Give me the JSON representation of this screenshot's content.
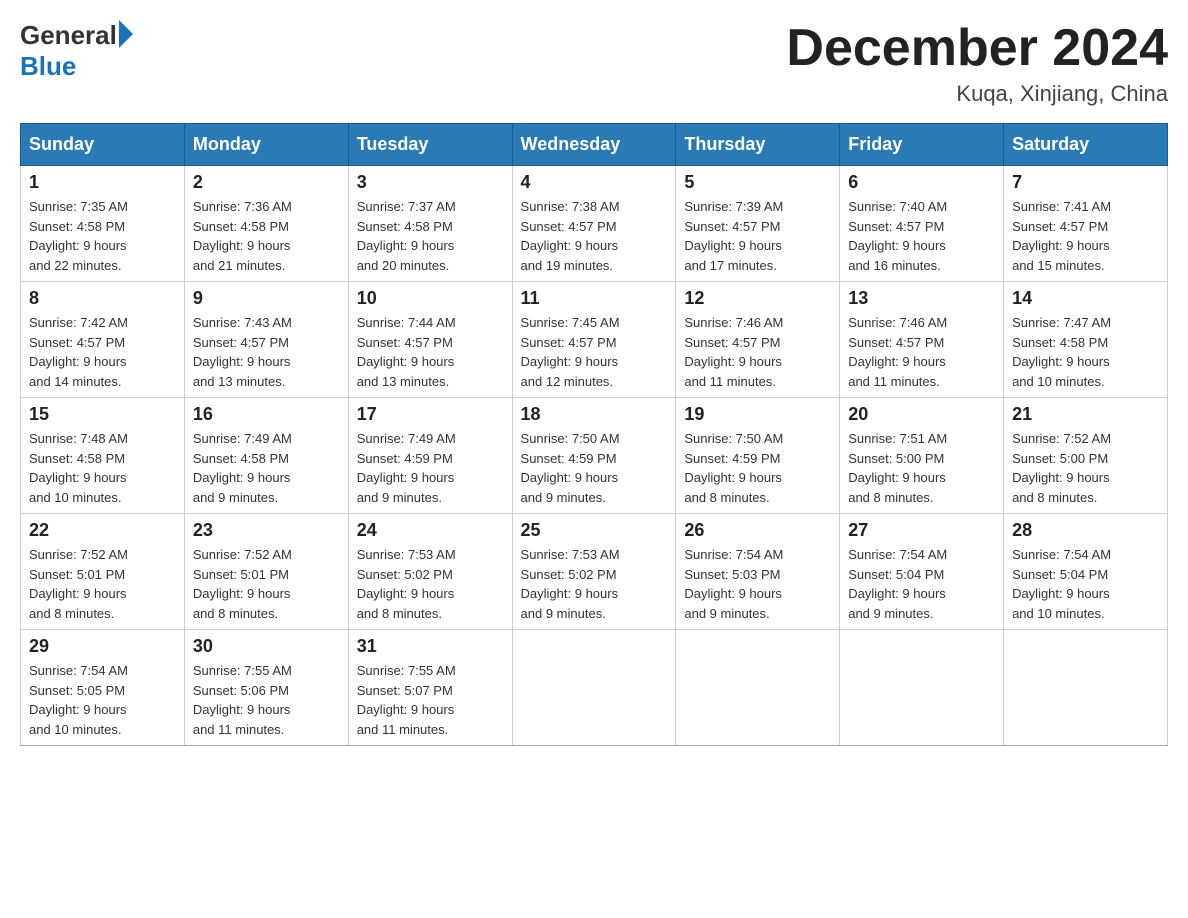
{
  "header": {
    "logo_general": "General",
    "logo_blue": "Blue",
    "month_title": "December 2024",
    "location": "Kuqa, Xinjiang, China"
  },
  "days_of_week": [
    "Sunday",
    "Monday",
    "Tuesday",
    "Wednesday",
    "Thursday",
    "Friday",
    "Saturday"
  ],
  "weeks": [
    [
      {
        "day": "1",
        "sunrise": "7:35 AM",
        "sunset": "4:58 PM",
        "daylight": "9 hours and 22 minutes."
      },
      {
        "day": "2",
        "sunrise": "7:36 AM",
        "sunset": "4:58 PM",
        "daylight": "9 hours and 21 minutes."
      },
      {
        "day": "3",
        "sunrise": "7:37 AM",
        "sunset": "4:58 PM",
        "daylight": "9 hours and 20 minutes."
      },
      {
        "day": "4",
        "sunrise": "7:38 AM",
        "sunset": "4:57 PM",
        "daylight": "9 hours and 19 minutes."
      },
      {
        "day": "5",
        "sunrise": "7:39 AM",
        "sunset": "4:57 PM",
        "daylight": "9 hours and 17 minutes."
      },
      {
        "day": "6",
        "sunrise": "7:40 AM",
        "sunset": "4:57 PM",
        "daylight": "9 hours and 16 minutes."
      },
      {
        "day": "7",
        "sunrise": "7:41 AM",
        "sunset": "4:57 PM",
        "daylight": "9 hours and 15 minutes."
      }
    ],
    [
      {
        "day": "8",
        "sunrise": "7:42 AM",
        "sunset": "4:57 PM",
        "daylight": "9 hours and 14 minutes."
      },
      {
        "day": "9",
        "sunrise": "7:43 AM",
        "sunset": "4:57 PM",
        "daylight": "9 hours and 13 minutes."
      },
      {
        "day": "10",
        "sunrise": "7:44 AM",
        "sunset": "4:57 PM",
        "daylight": "9 hours and 13 minutes."
      },
      {
        "day": "11",
        "sunrise": "7:45 AM",
        "sunset": "4:57 PM",
        "daylight": "9 hours and 12 minutes."
      },
      {
        "day": "12",
        "sunrise": "7:46 AM",
        "sunset": "4:57 PM",
        "daylight": "9 hours and 11 minutes."
      },
      {
        "day": "13",
        "sunrise": "7:46 AM",
        "sunset": "4:57 PM",
        "daylight": "9 hours and 11 minutes."
      },
      {
        "day": "14",
        "sunrise": "7:47 AM",
        "sunset": "4:58 PM",
        "daylight": "9 hours and 10 minutes."
      }
    ],
    [
      {
        "day": "15",
        "sunrise": "7:48 AM",
        "sunset": "4:58 PM",
        "daylight": "9 hours and 10 minutes."
      },
      {
        "day": "16",
        "sunrise": "7:49 AM",
        "sunset": "4:58 PM",
        "daylight": "9 hours and 9 minutes."
      },
      {
        "day": "17",
        "sunrise": "7:49 AM",
        "sunset": "4:59 PM",
        "daylight": "9 hours and 9 minutes."
      },
      {
        "day": "18",
        "sunrise": "7:50 AM",
        "sunset": "4:59 PM",
        "daylight": "9 hours and 9 minutes."
      },
      {
        "day": "19",
        "sunrise": "7:50 AM",
        "sunset": "4:59 PM",
        "daylight": "9 hours and 8 minutes."
      },
      {
        "day": "20",
        "sunrise": "7:51 AM",
        "sunset": "5:00 PM",
        "daylight": "9 hours and 8 minutes."
      },
      {
        "day": "21",
        "sunrise": "7:52 AM",
        "sunset": "5:00 PM",
        "daylight": "9 hours and 8 minutes."
      }
    ],
    [
      {
        "day": "22",
        "sunrise": "7:52 AM",
        "sunset": "5:01 PM",
        "daylight": "9 hours and 8 minutes."
      },
      {
        "day": "23",
        "sunrise": "7:52 AM",
        "sunset": "5:01 PM",
        "daylight": "9 hours and 8 minutes."
      },
      {
        "day": "24",
        "sunrise": "7:53 AM",
        "sunset": "5:02 PM",
        "daylight": "9 hours and 8 minutes."
      },
      {
        "day": "25",
        "sunrise": "7:53 AM",
        "sunset": "5:02 PM",
        "daylight": "9 hours and 9 minutes."
      },
      {
        "day": "26",
        "sunrise": "7:54 AM",
        "sunset": "5:03 PM",
        "daylight": "9 hours and 9 minutes."
      },
      {
        "day": "27",
        "sunrise": "7:54 AM",
        "sunset": "5:04 PM",
        "daylight": "9 hours and 9 minutes."
      },
      {
        "day": "28",
        "sunrise": "7:54 AM",
        "sunset": "5:04 PM",
        "daylight": "9 hours and 10 minutes."
      }
    ],
    [
      {
        "day": "29",
        "sunrise": "7:54 AM",
        "sunset": "5:05 PM",
        "daylight": "9 hours and 10 minutes."
      },
      {
        "day": "30",
        "sunrise": "7:55 AM",
        "sunset": "5:06 PM",
        "daylight": "9 hours and 11 minutes."
      },
      {
        "day": "31",
        "sunrise": "7:55 AM",
        "sunset": "5:07 PM",
        "daylight": "9 hours and 11 minutes."
      },
      null,
      null,
      null,
      null
    ]
  ],
  "labels": {
    "sunrise": "Sunrise:",
    "sunset": "Sunset:",
    "daylight": "Daylight:"
  }
}
